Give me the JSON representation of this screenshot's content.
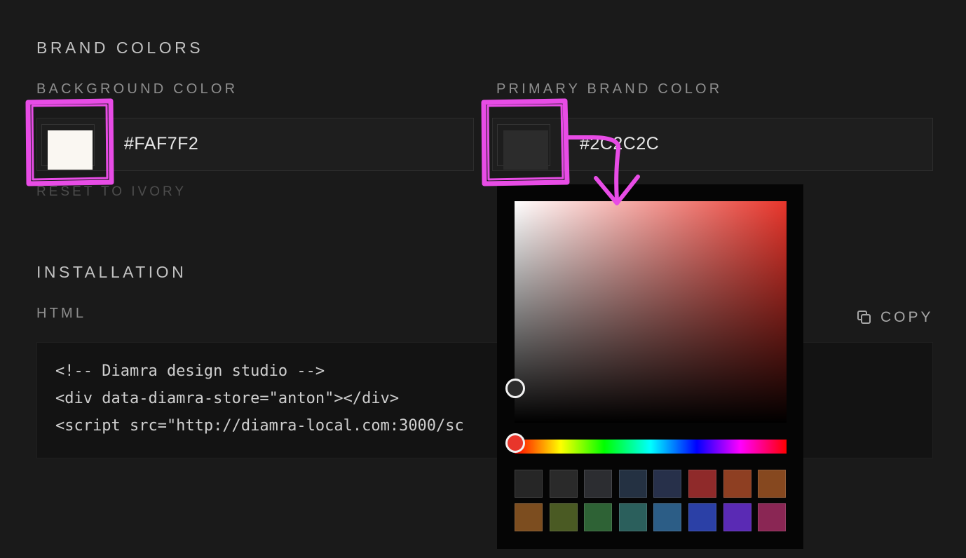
{
  "brand": {
    "section_title": "BRAND COLORS",
    "background": {
      "label": "BACKGROUND COLOR",
      "value": "#FAF7F2",
      "swatch_color": "#FAF7F2",
      "reset_label": "RESET TO IVORY"
    },
    "primary": {
      "label": "PRIMARY BRAND COLOR",
      "value": "#2C2C2C",
      "swatch_color": "#2C2C2C"
    }
  },
  "installation": {
    "section_title": "INSTALLATION",
    "code_label": "HTML",
    "copy_label": "COPY",
    "code_lines": [
      "<!-- Diamra design studio -->",
      "<div data-diamra-store=\"anton\"></div>",
      "<script src=\"http://diamra-local.com:3000/sc"
    ]
  },
  "color_picker": {
    "hue_color": "#E8352B",
    "presets": [
      "#262626",
      "#2a2a2a",
      "#2c2d31",
      "#243142",
      "#27304a",
      "#8f2a2a",
      "#8e3f22",
      "#86481f",
      "#7c4d1f",
      "#4a5a23",
      "#2e6235",
      "#2b5f5c",
      "#2c5d86",
      "#2b40a6",
      "#5a2ab4",
      "#8a2654"
    ]
  },
  "colors": {
    "page_background": "#1a1a1a",
    "annotation_magenta": "#e84ce6"
  }
}
